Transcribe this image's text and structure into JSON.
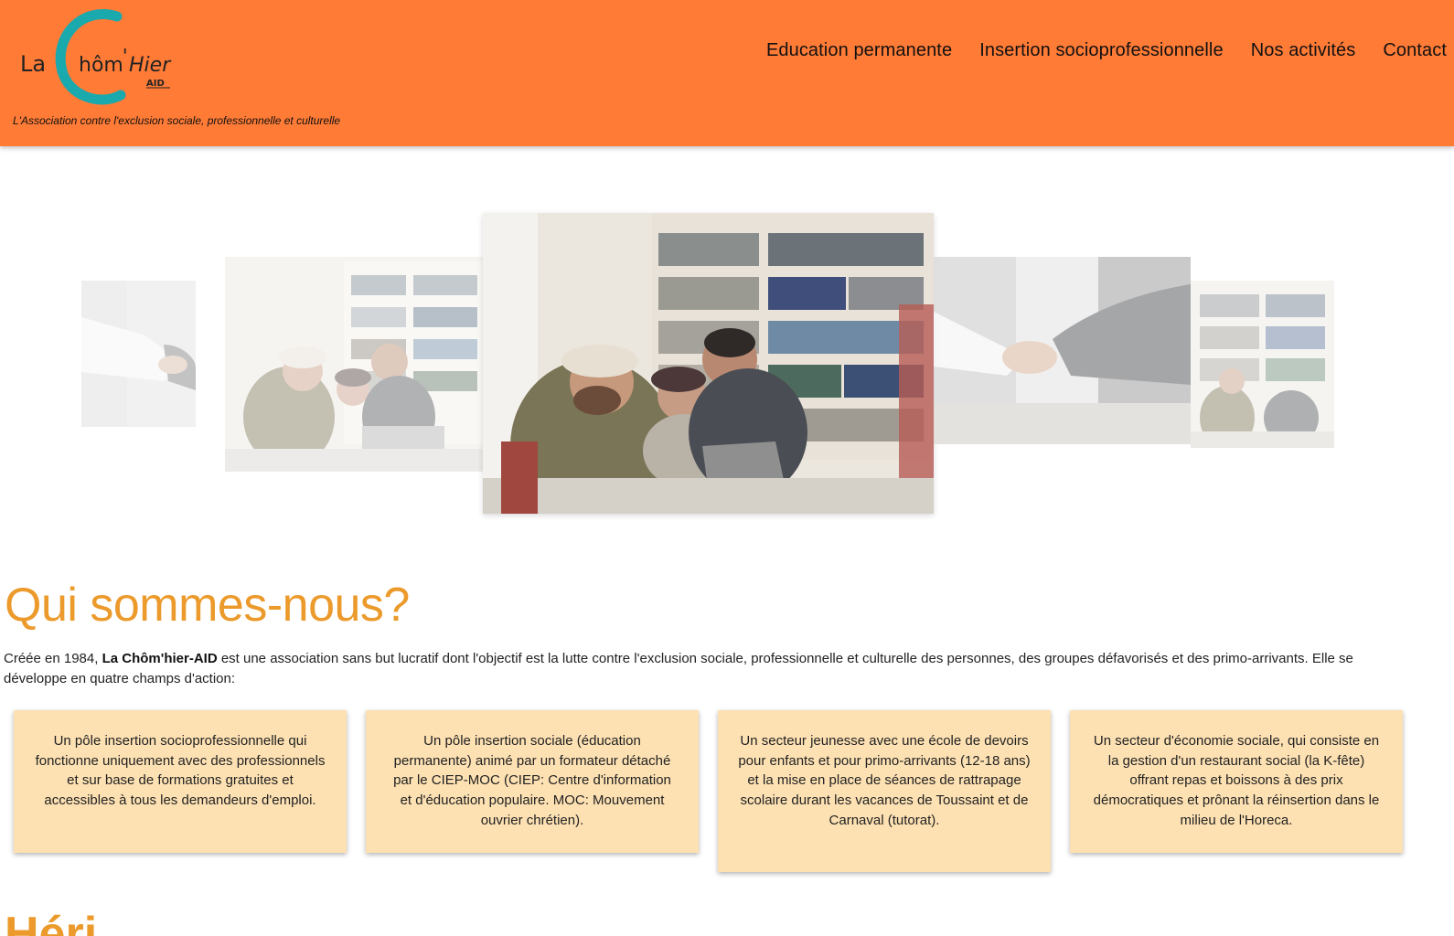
{
  "header": {
    "logo": {
      "word_la": "La",
      "word_chom": "hôm",
      "apostrophe": "'",
      "word_hier": "Hier",
      "word_aid": "AID",
      "c_color": "#1aa9ac"
    },
    "tagline": "L'Association contre l'exclusion sociale, professionnelle et culturelle",
    "background_color": "#ff7b36"
  },
  "nav": {
    "items": [
      {
        "label": "Education permanente"
      },
      {
        "label": "Insertion socioprofessionnelle"
      },
      {
        "label": "Nos activités"
      },
      {
        "label": "Contact"
      }
    ]
  },
  "carousel": {
    "slides": [
      {
        "icon": "handshake-photo",
        "active": false
      },
      {
        "icon": "library-team-photo",
        "active": false
      },
      {
        "icon": "library-team-photo",
        "active": true
      },
      {
        "icon": "handshake-photo",
        "active": false
      },
      {
        "icon": "library-team-photo",
        "active": false
      }
    ]
  },
  "section": {
    "title": "Qui sommes-nous?",
    "intro_before": "Créée en 1984, ",
    "intro_bold": "La Chôm'hier-AID",
    "intro_after": " est une association sans but lucratif dont l'objectif est la lutte contre l'exclusion sociale, professionnelle et culturelle des personnes, des groupes défavorisés et des primo-arrivants. Elle se développe en quatre champs d'action:",
    "title_color": "#eb9a2b",
    "card_color": "#fde1b3",
    "cards": [
      {
        "text": "Un pôle insertion socioprofessionnelle qui fonctionne uniquement avec des professionnels et sur base de formations gratuites et accessibles à tous les demandeurs d'emploi."
      },
      {
        "text": "Un pôle insertion sociale (éducation permanente) animé par un formateur détaché par le CIEP-MOC (CIEP: Centre d'information et d'éducation populaire. MOC: Mouvement ouvrier chrétien)."
      },
      {
        "text": "Un secteur jeunesse avec une école de devoirs pour enfants et pour primo-arrivants (12-18 ans) et la mise en place de séances de rattrapage scolaire durant les vacances de Toussaint et de Carnaval (tutorat)."
      },
      {
        "text": "Un secteur d'économie sociale, qui consiste en la gestion d'un restaurant social (la K-fête) offrant repas et boissons à des prix démocratiques et prônant la réinsertion dans le milieu de l'Horeca."
      }
    ],
    "next_heading": "Héri"
  }
}
